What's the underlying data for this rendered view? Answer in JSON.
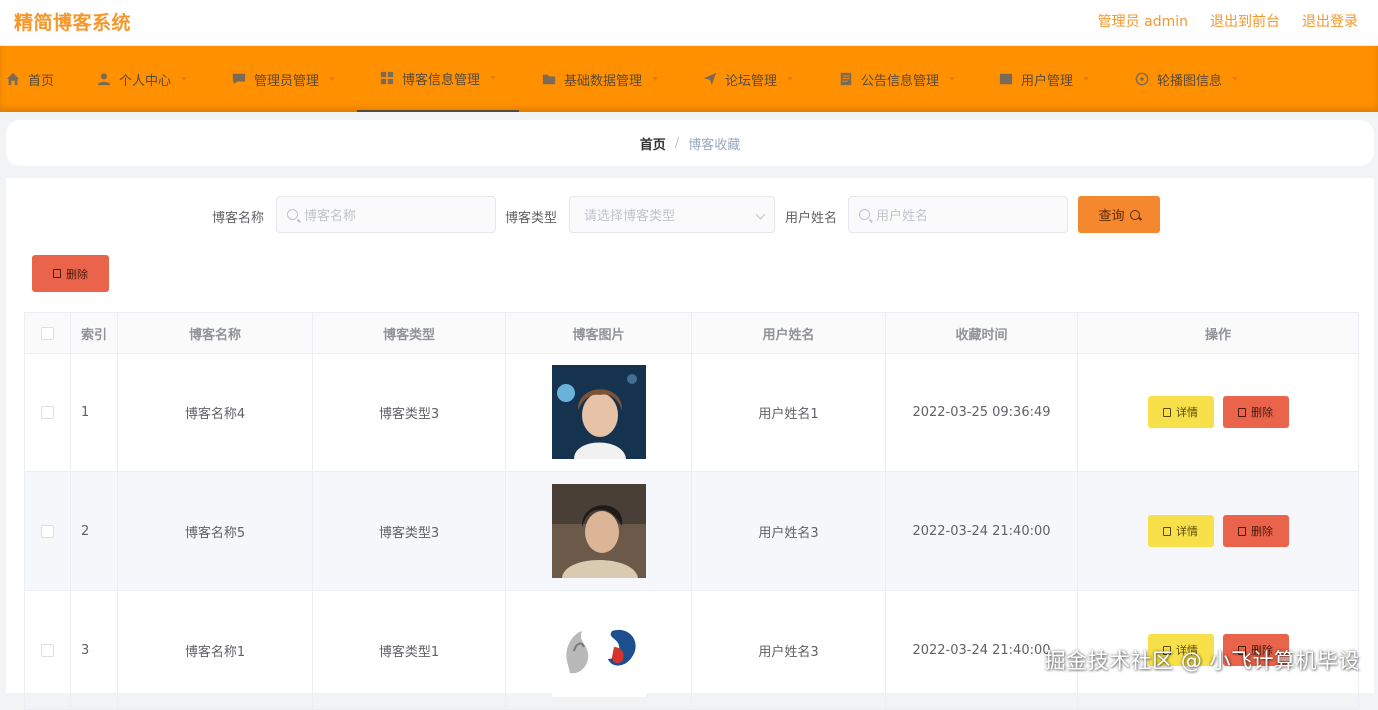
{
  "header": {
    "app_title": "精简博客系统",
    "admin_label": "管理员 admin",
    "front_link": "退出到前台",
    "logout_link": "退出登录"
  },
  "nav": {
    "items": [
      {
        "label": "首页",
        "icon": "home-icon"
      },
      {
        "label": "个人中心",
        "icon": "user-icon"
      },
      {
        "label": "管理员管理",
        "icon": "chat-icon"
      },
      {
        "label": "博客信息管理",
        "icon": "grid-icon"
      },
      {
        "label": "基础数据管理",
        "icon": "folder-icon"
      },
      {
        "label": "论坛管理",
        "icon": "send-icon"
      },
      {
        "label": "公告信息管理",
        "icon": "doc-icon"
      },
      {
        "label": "用户管理",
        "icon": "users-icon"
      },
      {
        "label": "轮播图信息",
        "icon": "image-icon"
      }
    ]
  },
  "breadcrumb": {
    "home": "首页",
    "separator": "/",
    "current": "博客收藏"
  },
  "search": {
    "name_label": "博客名称",
    "name_placeholder": "博客名称",
    "type_label": "博客类型",
    "type_placeholder": "请选择博客类型",
    "user_label": "用户姓名",
    "user_placeholder": "用户姓名",
    "query_button": "查询"
  },
  "toolbar": {
    "delete_label": "删除"
  },
  "table": {
    "headers": [
      "",
      "索引",
      "博客名称",
      "博客类型",
      "博客图片",
      "用户姓名",
      "收藏时间",
      "操作"
    ],
    "rows": [
      {
        "index": "1",
        "name": "博客名称4",
        "type": "博客类型3",
        "user": "用户姓名1",
        "time": "2022-03-25 09:36:49"
      },
      {
        "index": "2",
        "name": "博客名称5",
        "type": "博客类型3",
        "user": "用户姓名3",
        "time": "2022-03-24 21:40:00"
      },
      {
        "index": "3",
        "name": "博客名称1",
        "type": "博客类型1",
        "user": "用户姓名3",
        "time": "2022-03-24 21:40:00"
      }
    ],
    "detail_label": "详情",
    "delete_label": "删除"
  },
  "watermark": "掘金技术社区 @ 小飞计算机毕设",
  "colors": {
    "accent": "#ff9000",
    "title": "#f5972a",
    "query": "#f5872f",
    "danger": "#e9644a",
    "detail": "#f7e04a"
  }
}
